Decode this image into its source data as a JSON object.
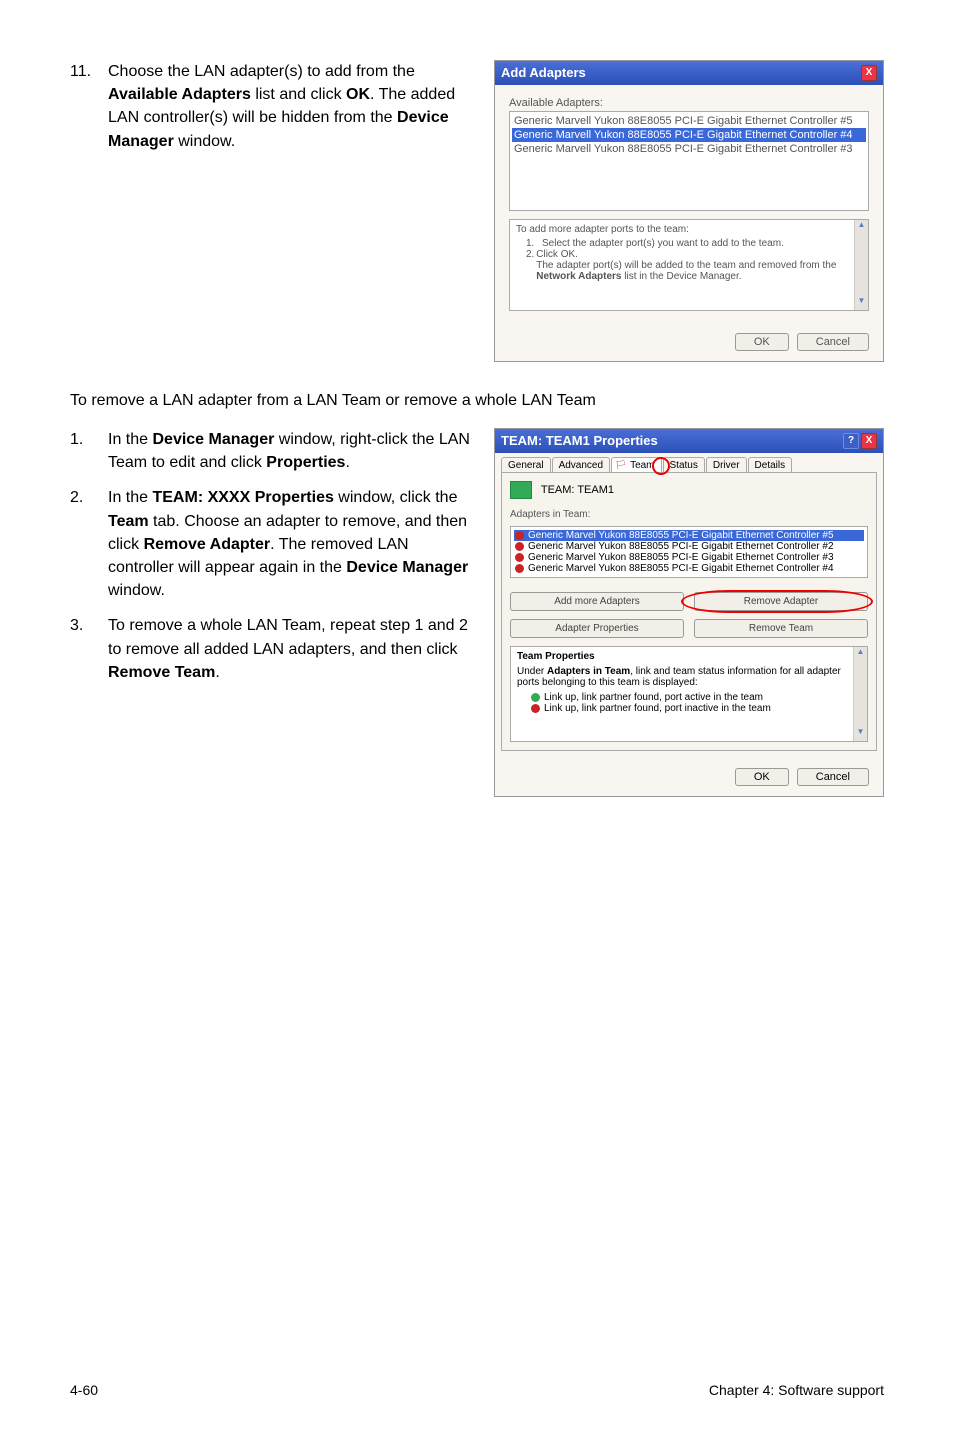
{
  "step11": {
    "num": "11.",
    "text_before": "Choose the LAN adapter(s) to add from the ",
    "bold1": "Available Adapters",
    "text_mid1": " list and click ",
    "bold2": "OK",
    "text_mid2": ". The added LAN controller(s) will be hidden from the ",
    "bold3": "Device Manager",
    "text_after": " window."
  },
  "addDlg": {
    "title": "Add Adapters",
    "close": "X",
    "availLabel": "Available Adapters:",
    "items": [
      "Generic Marvell Yukon 88E8055 PCI-E Gigabit Ethernet Controller #5",
      "Generic Marvell Yukon 88E8055 PCI-E Gigabit Ethernet Controller #4",
      "Generic Marvell Yukon 88E8055 PCI-E Gigabit Ethernet Controller #3"
    ],
    "instrTitle": "To add more adapter ports to the team:",
    "instr1n": "1.",
    "instr1": "Select the adapter port(s) you want to add to the team.",
    "instr2n": "2.",
    "instr2a": "Click OK.",
    "instr2b_pre": "The adapter port(s) will be added to the team and removed from the ",
    "instr2b_bold": "Network Adapters",
    "instr2b_post": " list in the Device Manager.",
    "ok": "OK",
    "cancel": "Cancel"
  },
  "midText": "To remove a LAN adapter from a LAN Team or remove a whole LAN Team",
  "steps2": {
    "s1": {
      "num": "1.",
      "t1": "In the ",
      "b1": "Device Manager",
      "t2": " window, right-click the LAN Team to edit and click ",
      "b2": "Properties",
      "t3": "."
    },
    "s2": {
      "num": "2.",
      "t1": "In the ",
      "b1": "TEAM: XXXX Properties",
      "t2": " window, click the ",
      "b2": "Team",
      "t3": " tab. Choose an adapter to remove, and then click ",
      "b3": "Remove Adapter",
      "t4": ". The removed LAN controller will appear again in the ",
      "b4": "Device Manager",
      "t5": " window."
    },
    "s3": {
      "num": "3.",
      "t1": "To remove a whole LAN Team, repeat step 1 and 2 to remove all added LAN adapters, and then click ",
      "b1": "Remove Team",
      "t2": "."
    }
  },
  "teamDlg": {
    "title": "TEAM: TEAM1 Properties",
    "help": "?",
    "close": "X",
    "tabs": {
      "general": "General",
      "advanced": "Advanced",
      "team": "Team",
      "status": "Status",
      "driver": "Driver",
      "details": "Details"
    },
    "teamLabel": "TEAM: TEAM1",
    "adaptersLabel": "Adapters in Team:",
    "adapters": [
      "Generic Marvel Yukon 88E8055 PCI-E Gigabit Ethernet Controller #5",
      "Generic Marvel Yukon 88E8055 PCI-E Gigabit Ethernet Controller #2",
      "Generic Marvel Yukon 88E8055 PCI-E Gigabit Ethernet Controller #3",
      "Generic Marvel Yukon 88E8055 PCI-E Gigabit Ethernet Controller #4"
    ],
    "btnAddMore": "Add more Adapters",
    "btnRemoveAdapter": "Remove Adapter",
    "btnAdapterProps": "Adapter Properties",
    "btnRemoveTeam": "Remove Team",
    "propsTitle": "Team Properties",
    "propsDesc_pre": "Under ",
    "propsDesc_bold": "Adapters in Team",
    "propsDesc_post": ", link and team status information for all adapter ports belonging to this team is displayed:",
    "propsLine1": "Link up, link partner found, port active in the team",
    "propsLine2": "Link up, link partner found, port inactive in the team",
    "ok": "OK",
    "cancel": "Cancel"
  },
  "footer": {
    "left": "4-60",
    "right": "Chapter 4: Software support"
  }
}
